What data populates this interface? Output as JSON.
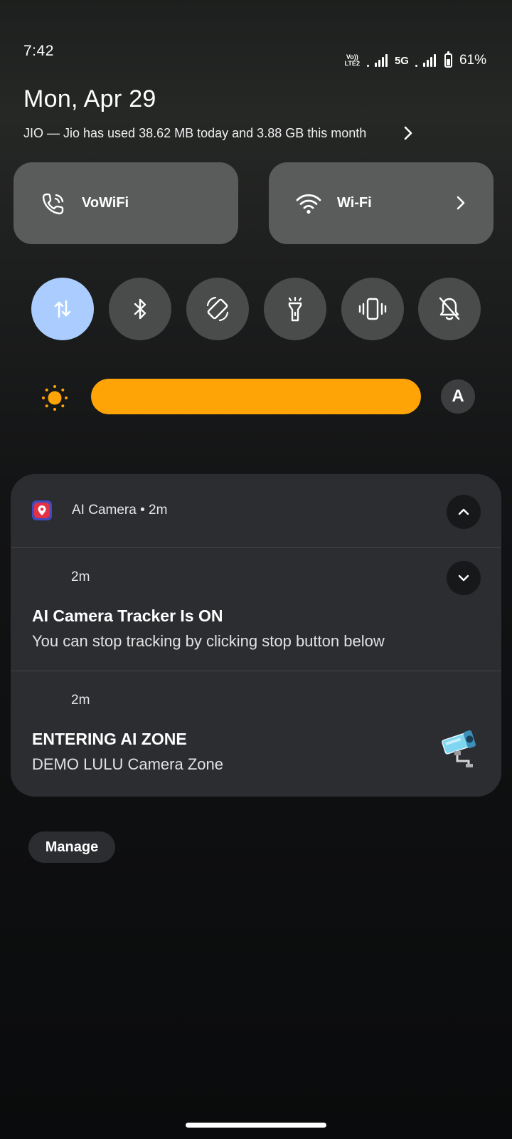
{
  "status_bar": {
    "time": "7:42",
    "volte_top": "Vo))",
    "volte_bottom": "LTE2",
    "network_label": "5G",
    "battery_percent": "61%",
    "battery_level": 0.61
  },
  "header": {
    "date": "Mon, Apr 29",
    "carrier_info": "JIO — Jio has used 38.62 MB today and 3.88 GB this month"
  },
  "tiles": {
    "vowifi_label": "VoWiFi",
    "wifi_label": "Wi-Fi"
  },
  "toggles": [
    {
      "icon": "mobile-data-icon",
      "active": true
    },
    {
      "icon": "bluetooth-icon",
      "active": false
    },
    {
      "icon": "auto-rotate-icon",
      "active": false
    },
    {
      "icon": "flashlight-icon",
      "active": false
    },
    {
      "icon": "vibrate-icon",
      "active": false
    },
    {
      "icon": "do-not-disturb-icon",
      "active": false
    }
  ],
  "brightness": {
    "level": 1.0,
    "auto_label": "A",
    "fill_color": "#ffa406"
  },
  "notification_group": {
    "app_name": "AI Camera • 2m",
    "notifications": [
      {
        "time": "2m",
        "title": "AI Camera Tracker Is ON",
        "body": "You can stop tracking by clicking stop button below"
      },
      {
        "time": "2m",
        "title": "ENTERING AI ZONE",
        "body": "DEMO LULU Camera Zone"
      }
    ]
  },
  "manage_label": "Manage"
}
